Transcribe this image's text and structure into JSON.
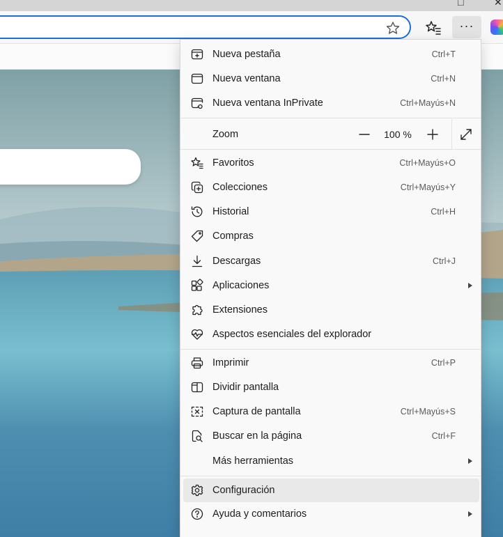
{
  "window": {
    "restore_glyph": "□",
    "close_glyph": "✕"
  },
  "toolbar": {
    "more_label": "···"
  },
  "menu": {
    "items": [
      {
        "label": "Nueva pestaña",
        "shortcut": "Ctrl+T",
        "icon": "new-tab-icon"
      },
      {
        "label": "Nueva ventana",
        "shortcut": "Ctrl+N",
        "icon": "new-window-icon"
      },
      {
        "label": "Nueva ventana InPrivate",
        "shortcut": "Ctrl+Mayús+N",
        "icon": "inprivate-icon"
      },
      {
        "label": "Favoritos",
        "shortcut": "Ctrl+Mayús+O",
        "icon": "favorites-icon"
      },
      {
        "label": "Colecciones",
        "shortcut": "Ctrl+Mayús+Y",
        "icon": "collections-icon"
      },
      {
        "label": "Historial",
        "shortcut": "Ctrl+H",
        "icon": "history-icon"
      },
      {
        "label": "Compras",
        "shortcut": "",
        "icon": "tag-icon"
      },
      {
        "label": "Descargas",
        "shortcut": "Ctrl+J",
        "icon": "download-icon"
      },
      {
        "label": "Aplicaciones",
        "shortcut": "",
        "icon": "apps-icon",
        "submenu": true
      },
      {
        "label": "Extensiones",
        "shortcut": "",
        "icon": "puzzle-icon"
      },
      {
        "label": "Aspectos esenciales del explorador",
        "shortcut": "",
        "icon": "heartbeat-icon"
      },
      {
        "label": "Imprimir",
        "shortcut": "Ctrl+P",
        "icon": "printer-icon"
      },
      {
        "label": "Dividir pantalla",
        "shortcut": "",
        "icon": "split-screen-icon"
      },
      {
        "label": "Captura de pantalla",
        "shortcut": "Ctrl+Mayús+S",
        "icon": "screenshot-icon"
      },
      {
        "label": "Buscar en la página",
        "shortcut": "Ctrl+F",
        "icon": "find-icon"
      },
      {
        "label": "Más herramientas",
        "shortcut": "",
        "icon": "",
        "submenu": true
      },
      {
        "label": "Configuración",
        "shortcut": "",
        "icon": "gear-icon",
        "hovered": true
      },
      {
        "label": "Ayuda y comentarios",
        "shortcut": "",
        "icon": "help-icon",
        "submenu": true
      }
    ],
    "zoom": {
      "label": "Zoom",
      "value": "100 %",
      "minus": "−",
      "plus": "+"
    }
  },
  "colors": {
    "accent": "#1a6fd6",
    "menu_bg": "#f9f9f9",
    "hover_bg": "#e9e9e9"
  }
}
